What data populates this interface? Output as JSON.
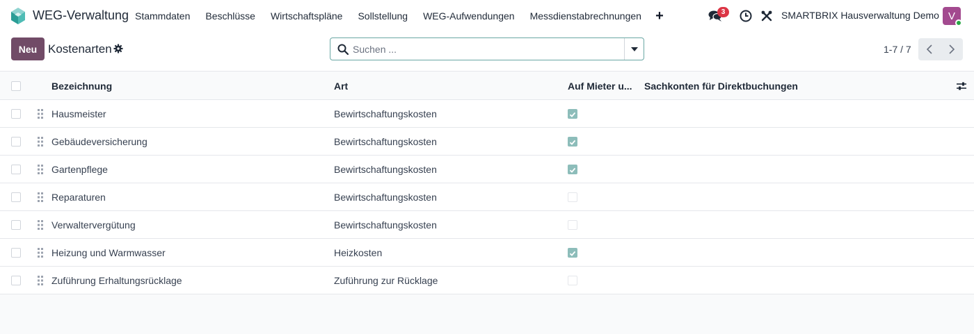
{
  "navbar": {
    "app_title": "WEG-Verwaltung",
    "menu": [
      "Stammdaten",
      "Beschlüsse",
      "Wirtschaftspläne",
      "Sollstellung",
      "WEG-Aufwendungen",
      "Messdienstabrechnungen"
    ],
    "plus_icon": "+",
    "messages_badge": "3",
    "company": "SMARTBRIX Hausverwaltung Demo",
    "avatar_initial": "V",
    "brand_color": "#714b67",
    "badge_color": "#dc3545"
  },
  "control": {
    "new_label": "Neu",
    "page_title": "Kostenarten",
    "search_placeholder": "Suchen ...",
    "pager": "1-7 / 7"
  },
  "list": {
    "columns": [
      "Bezeichnung",
      "Art",
      "Auf Mieter u...",
      "Sachkonten für Direktbuchungen"
    ],
    "rows": [
      {
        "name": "Hausmeister",
        "art": "Bewirtschaftungskosten",
        "mieter": true
      },
      {
        "name": "Gebäudeversicherung",
        "art": "Bewirtschaftungskosten",
        "mieter": true
      },
      {
        "name": "Gartenpflege",
        "art": "Bewirtschaftungskosten",
        "mieter": true
      },
      {
        "name": "Reparaturen",
        "art": "Bewirtschaftungskosten",
        "mieter": false
      },
      {
        "name": "Verwaltervergütung",
        "art": "Bewirtschaftungskosten",
        "mieter": false
      },
      {
        "name": "Heizung und Warmwasser",
        "art": "Heizkosten",
        "mieter": true
      },
      {
        "name": "Zuführung Erhaltungsrücklage",
        "art": "Zuführung zur Rücklage",
        "mieter": false
      }
    ]
  }
}
